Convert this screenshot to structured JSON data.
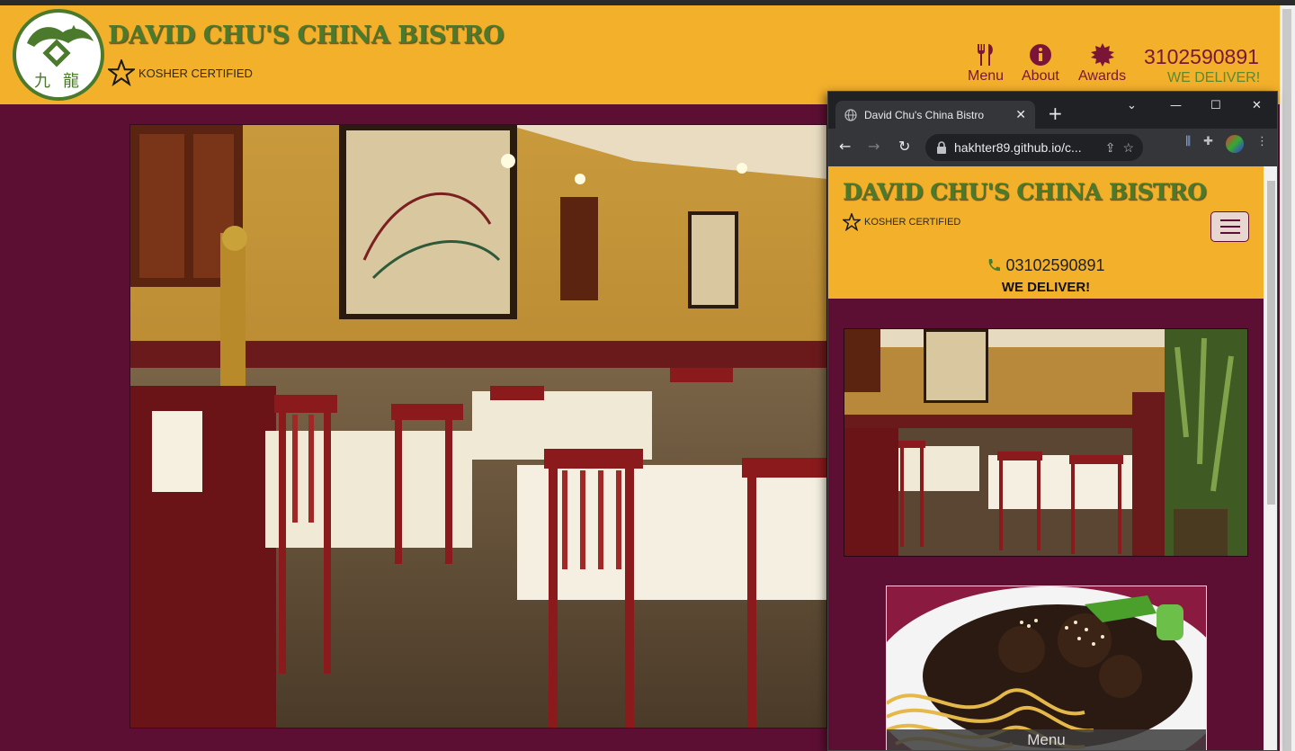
{
  "site": {
    "title": "DAVID CHU'S CHINA BISTRO",
    "kosher": "KOSHER CERTIFIED",
    "nav": [
      {
        "label": "Menu",
        "icon": "fork-knife-icon"
      },
      {
        "label": "About",
        "icon": "info-icon"
      },
      {
        "label": "Awards",
        "icon": "certificate-icon"
      }
    ],
    "phone": "3102590891",
    "deliver": "WE DELIVER!",
    "colors": {
      "header": "#f2b02b",
      "body": "#5d0f33",
      "title": "#4b7a2c",
      "nav": "#7b1538"
    }
  },
  "browser": {
    "tab_title": "David Chu's China Bistro",
    "url": "hakhter89.github.io/c...",
    "mobile": {
      "title": "DAVID CHU'S CHINA BISTRO",
      "kosher": "KOSHER CERTIFIED",
      "phone": "03102590891",
      "deliver": "WE DELIVER!",
      "card_label": "Menu"
    }
  }
}
